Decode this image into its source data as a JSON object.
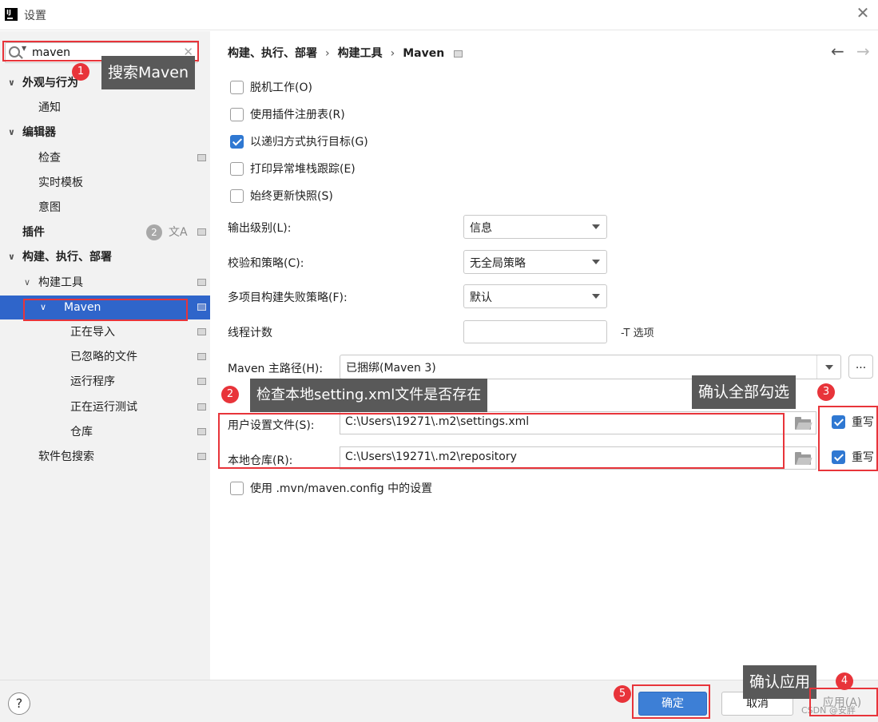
{
  "window": {
    "title": "设置",
    "app_icon_text": "IJ"
  },
  "sidebar": {
    "search_value": "maven",
    "items": [
      {
        "label": "外观与行为",
        "level": 0,
        "bold": true,
        "expanded": true
      },
      {
        "label": "通知",
        "level": 1
      },
      {
        "label": "编辑器",
        "level": 0,
        "bold": true,
        "expanded": true
      },
      {
        "label": "检查",
        "level": 1,
        "badge": true
      },
      {
        "label": "实时模板",
        "level": 1
      },
      {
        "label": "意图",
        "level": 1
      },
      {
        "label": "插件",
        "level": 0,
        "bold": true,
        "count": "2",
        "badge": true
      },
      {
        "label": "构建、执行、部署",
        "level": 0,
        "bold": true,
        "expanded": true
      },
      {
        "label": "构建工具",
        "level": 1,
        "expanded": true,
        "badge": true
      },
      {
        "label": "Maven",
        "level": 2,
        "expanded": true,
        "selected": true,
        "badge": true
      },
      {
        "label": "正在导入",
        "level": 3,
        "badge": true
      },
      {
        "label": "已忽略的文件",
        "level": 3,
        "badge": true
      },
      {
        "label": "运行程序",
        "level": 3,
        "badge": true
      },
      {
        "label": "正在运行测试",
        "level": 3,
        "badge": true
      },
      {
        "label": "仓库",
        "level": 3,
        "badge": true
      },
      {
        "label": "软件包搜索",
        "level": 1,
        "badge": true
      }
    ]
  },
  "breadcrumb": {
    "part1": "构建、执行、部署",
    "part2": "构建工具",
    "part3": "Maven",
    "sep": "›"
  },
  "nav": {
    "back": "←",
    "forward": "→"
  },
  "options": [
    {
      "label": "脱机工作(O)",
      "checked": false
    },
    {
      "label": "使用插件注册表(R)",
      "checked": false
    },
    {
      "label": "以递归方式执行目标(G)",
      "checked": true
    },
    {
      "label": "打印异常堆栈跟踪(E)",
      "checked": false
    },
    {
      "label": "始终更新快照(S)",
      "checked": false
    }
  ],
  "fields": {
    "output_level_label": "输出级别(L):",
    "output_level_value": "信息",
    "checksum_label": "校验和策略(C):",
    "checksum_value": "无全局策略",
    "multiproject_label": "多项目构建失败策略(F):",
    "multiproject_value": "默认",
    "threads_label": "线程计数",
    "threads_value": "",
    "threads_hint": "-T 选项",
    "home_label": "Maven 主路径(H):",
    "home_value": "已捆绑(Maven 3)",
    "dots": "...",
    "user_settings_label": "用户设置文件(S):",
    "user_settings_value": "C:\\Users\\19271\\.m2\\settings.xml",
    "local_repo_label": "本地仓库(R):",
    "local_repo_value": "C:\\Users\\19271\\.m2\\repository",
    "override_label": "重写",
    "mvn_config_label": "使用 .mvn/maven.config 中的设置"
  },
  "footer": {
    "help": "?",
    "ok": "确定",
    "cancel": "取消",
    "apply": "应用(A)",
    "watermark": "CSDN @安胖"
  },
  "annotations": {
    "m1": "1",
    "c1": "搜索Maven",
    "m2": "2",
    "c2": "检查本地setting.xml文件是否存在",
    "m3": "3",
    "c3": "确认全部勾选",
    "m4": "4",
    "c4": "确认应用",
    "m5": "5"
  },
  "colors": {
    "accent": "#2f65ca",
    "annotation_red": "#e8343a",
    "callout_bg": "#595959"
  }
}
